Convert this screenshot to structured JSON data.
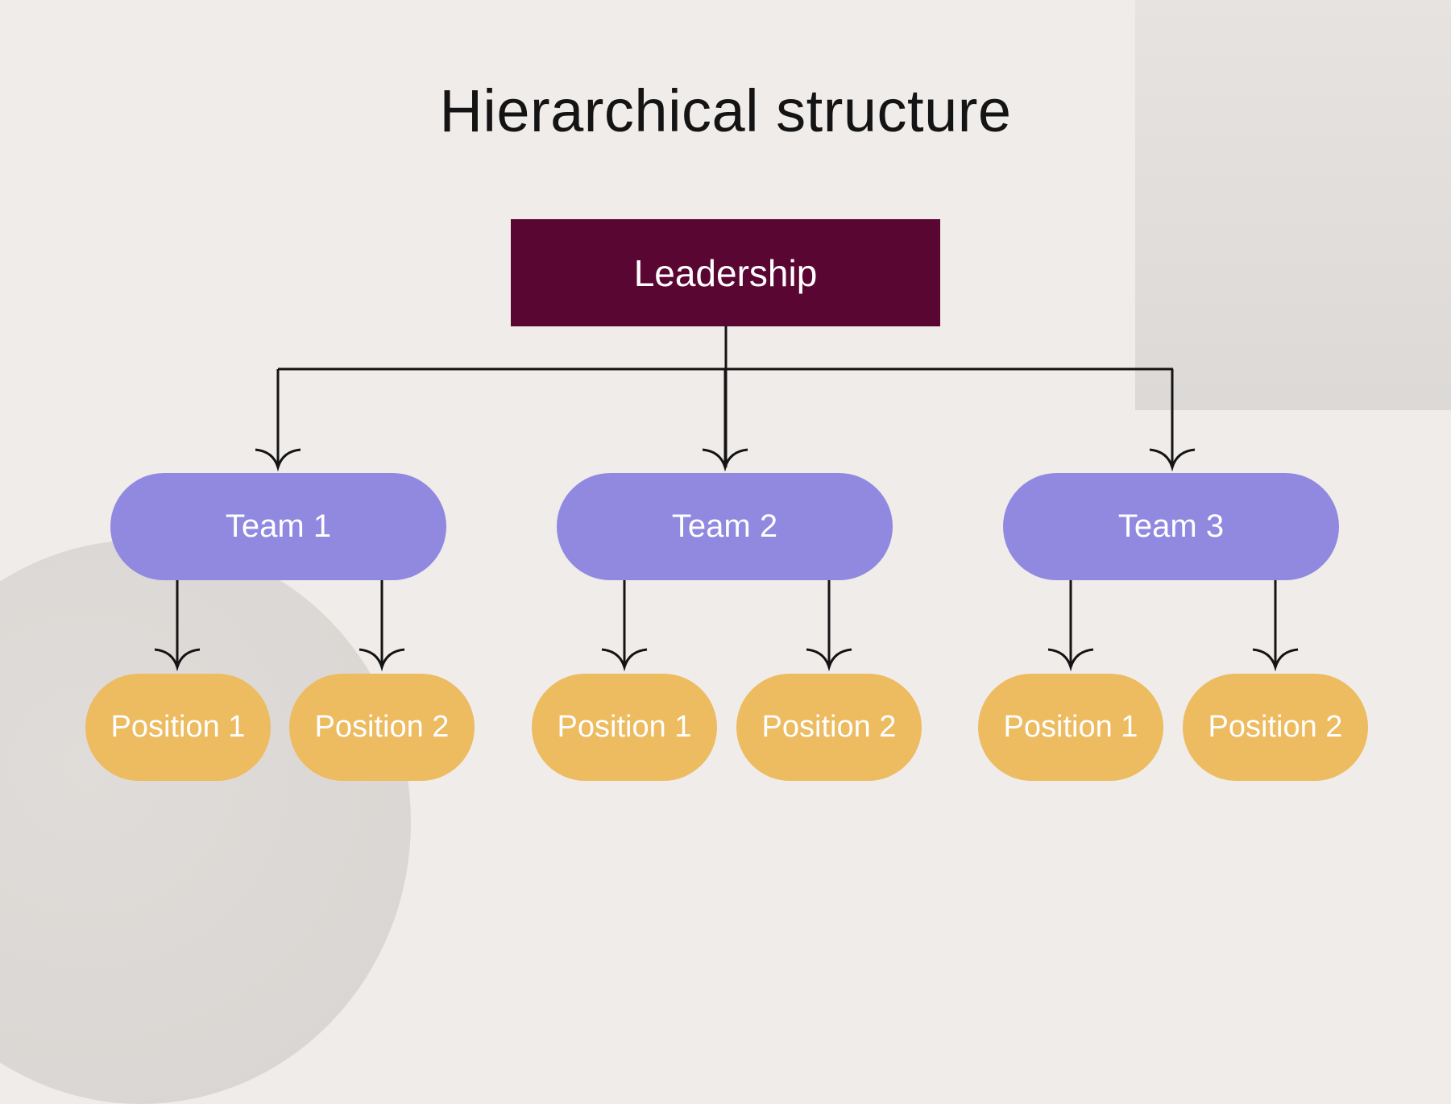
{
  "title": "Hierarchical structure",
  "colors": {
    "leadership": "#5a0633",
    "team": "#9189e0",
    "position": "#edbb60",
    "line": "#141414",
    "background": "#efecea"
  },
  "leadership": {
    "label": "Leadership"
  },
  "teams": [
    {
      "label": "Team 1",
      "positions": [
        "Position 1",
        "Position 2"
      ]
    },
    {
      "label": "Team 2",
      "positions": [
        "Position 1",
        "Position 2"
      ]
    },
    {
      "label": "Team 3",
      "positions": [
        "Position 1",
        "Position 2"
      ]
    }
  ]
}
